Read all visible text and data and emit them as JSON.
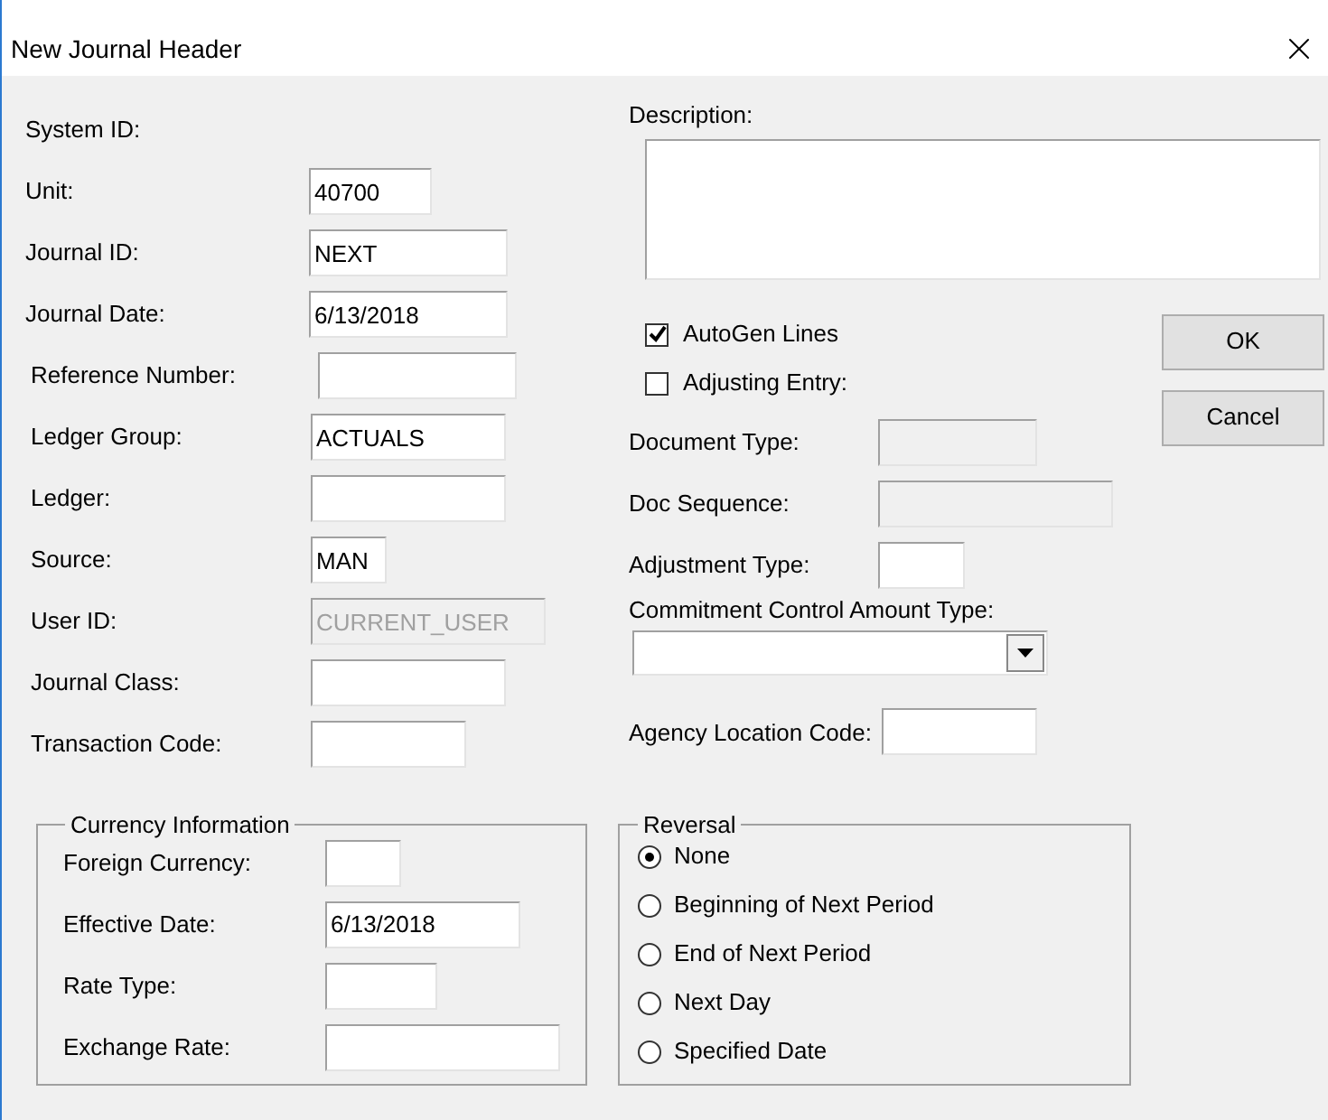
{
  "window": {
    "title": "New Journal Header"
  },
  "system_id": {
    "label": "System ID:"
  },
  "left_fields": [
    {
      "label": "Unit:",
      "value": "40700",
      "disabled": false
    },
    {
      "label": "Journal ID:",
      "value": "NEXT",
      "disabled": false
    },
    {
      "label": "Journal Date:",
      "value": "6/13/2018",
      "disabled": false
    },
    {
      "label": "Reference Number:",
      "disabled": false
    },
    {
      "label": "Ledger Group:",
      "value": "ACTUALS",
      "disabled": false
    },
    {
      "label": "Ledger:",
      "disabled": false
    },
    {
      "label": "Source:",
      "value": "MAN",
      "disabled": false
    },
    {
      "label": "User ID:",
      "value": "CURRENT_USER",
      "disabled": true
    },
    {
      "label": "Journal Class:",
      "disabled": false
    },
    {
      "label": "Transaction Code:",
      "disabled": false
    }
  ],
  "description": {
    "label": "Description:"
  },
  "checkboxes": [
    {
      "label": "AutoGen Lines",
      "checked": true
    },
    {
      "label": "Adjusting Entry:",
      "checked": false
    }
  ],
  "right_fields": [
    {
      "label": "Document Type:",
      "disabled": true
    },
    {
      "label": "Doc Sequence:",
      "disabled": true
    },
    {
      "label": "Adjustment Type:",
      "disabled": false
    }
  ],
  "commitment": {
    "label": "Commitment Control Amount Type:"
  },
  "agency": {
    "label": "Agency Location Code:",
    "disabled": false
  },
  "buttons": [
    "OK",
    "Cancel"
  ],
  "currency": {
    "title": "Currency Information",
    "fields": [
      {
        "label": "Foreign Currency:",
        "disabled": false
      },
      {
        "label": "Effective Date:",
        "value": "6/13/2018",
        "disabled": false
      },
      {
        "label": "Rate Type:",
        "disabled": false
      },
      {
        "label": "Exchange Rate:",
        "disabled": false
      }
    ]
  },
  "reversal": {
    "title": "Reversal",
    "options": [
      {
        "label": "None",
        "selected": true
      },
      {
        "label": "Beginning of Next Period",
        "selected": false
      },
      {
        "label": "End of Next Period",
        "selected": false
      },
      {
        "label": "Next Day",
        "selected": false
      },
      {
        "label": "Specified Date",
        "selected": false
      }
    ]
  }
}
